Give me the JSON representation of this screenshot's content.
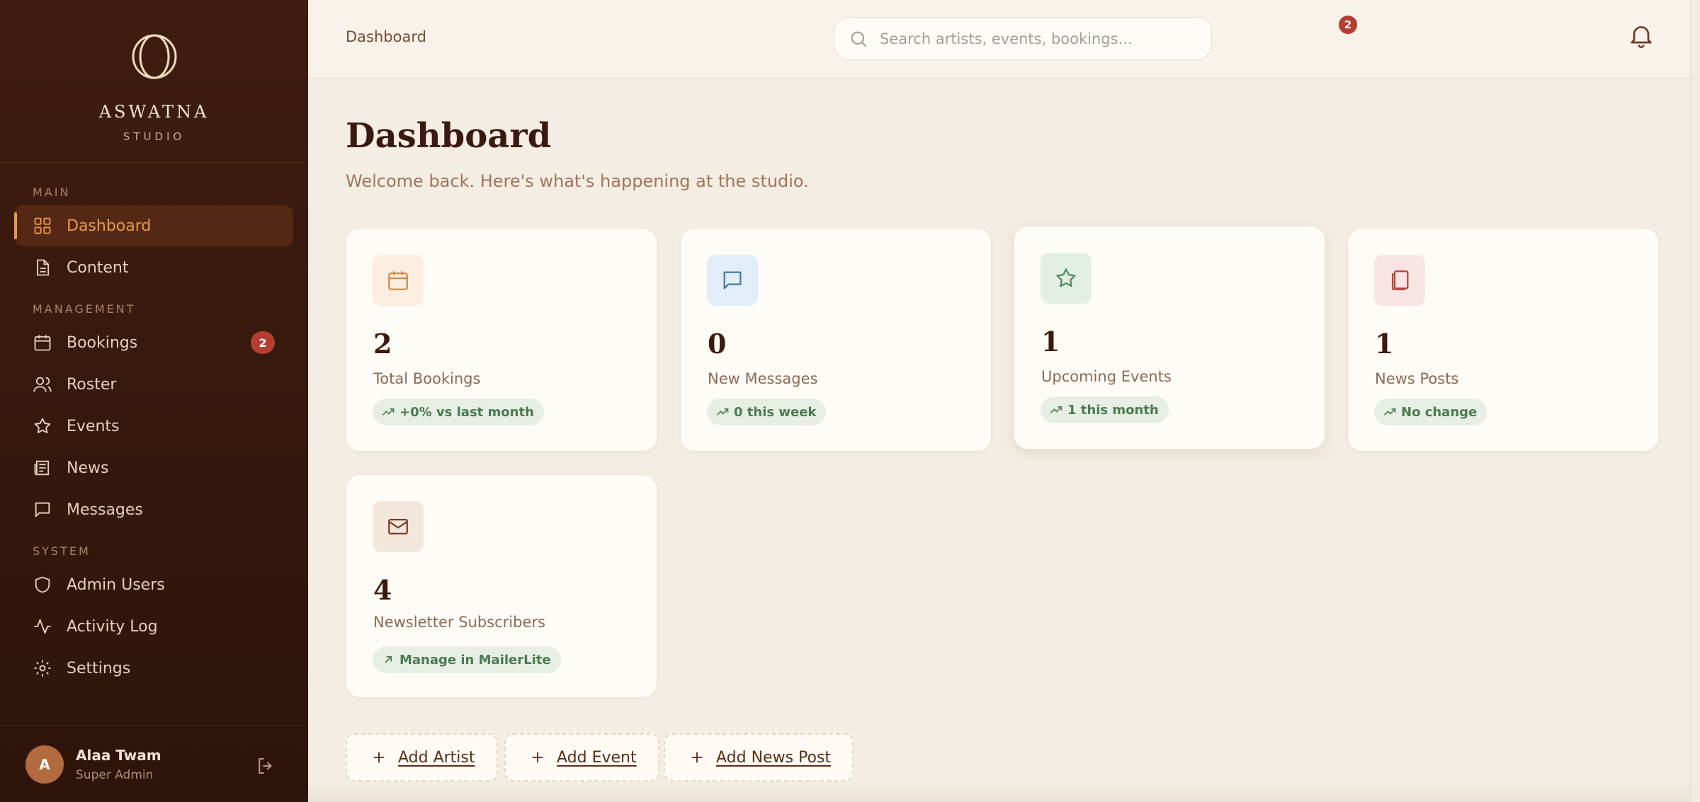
{
  "brand": {
    "name": "ASWATNA",
    "subtitle": "STUDIO"
  },
  "sidebar": {
    "sections": {
      "main": "MAIN",
      "management": "MANAGEMENT",
      "system": "SYSTEM"
    },
    "items": [
      {
        "label": "Dashboard",
        "icon": "grid-icon",
        "active": true
      },
      {
        "label": "Content",
        "icon": "document-icon"
      },
      {
        "label": "Bookings",
        "icon": "calendar-icon",
        "badge": "2"
      },
      {
        "label": "Roster",
        "icon": "users-icon"
      },
      {
        "label": "Events",
        "icon": "star-icon"
      },
      {
        "label": "News",
        "icon": "newspaper-icon"
      },
      {
        "label": "Messages",
        "icon": "message-icon"
      },
      {
        "label": "Admin Users",
        "icon": "shield-icon"
      },
      {
        "label": "Activity Log",
        "icon": "activity-icon"
      },
      {
        "label": "Settings",
        "icon": "gear-icon"
      }
    ]
  },
  "user": {
    "initial": "A",
    "name": "Alaa Twam",
    "role": "Super Admin"
  },
  "topbar": {
    "breadcrumb": "Dashboard",
    "search_placeholder": "Search artists, events, bookings...",
    "notification_count": "2"
  },
  "page": {
    "title": "Dashboard",
    "subtitle": "Welcome back. Here's what's happening at the studio."
  },
  "stats": [
    {
      "value": "2",
      "label": "Total Bookings",
      "trend": "+0% vs last month",
      "icon": "calendar-icon",
      "icon_bg": "#fbeee0",
      "icon_color": "#d08a4a"
    },
    {
      "value": "0",
      "label": "New Messages",
      "trend": "0 this week",
      "icon": "message-icon",
      "icon_bg": "#e3edf7",
      "icon_color": "#4a76a8"
    },
    {
      "value": "1",
      "label": "Upcoming Events",
      "trend": "1 this month",
      "icon": "star-icon",
      "icon_bg": "#e4efe4",
      "icon_color": "#4d8a5a"
    },
    {
      "value": "1",
      "label": "News Posts",
      "trend": "No change",
      "icon": "pages-icon",
      "icon_bg": "#f8e4e2",
      "icon_color": "#b5463b"
    },
    {
      "value": "4",
      "label": "Newsletter Subscribers",
      "trend": "Manage in MailerLite",
      "icon": "mail-icon",
      "icon_bg": "#f3e7dc",
      "icon_color": "#7a3e26"
    }
  ],
  "quick_actions": [
    {
      "label": "Add Artist"
    },
    {
      "label": "Add Event"
    },
    {
      "label": "Add News Post"
    }
  ]
}
